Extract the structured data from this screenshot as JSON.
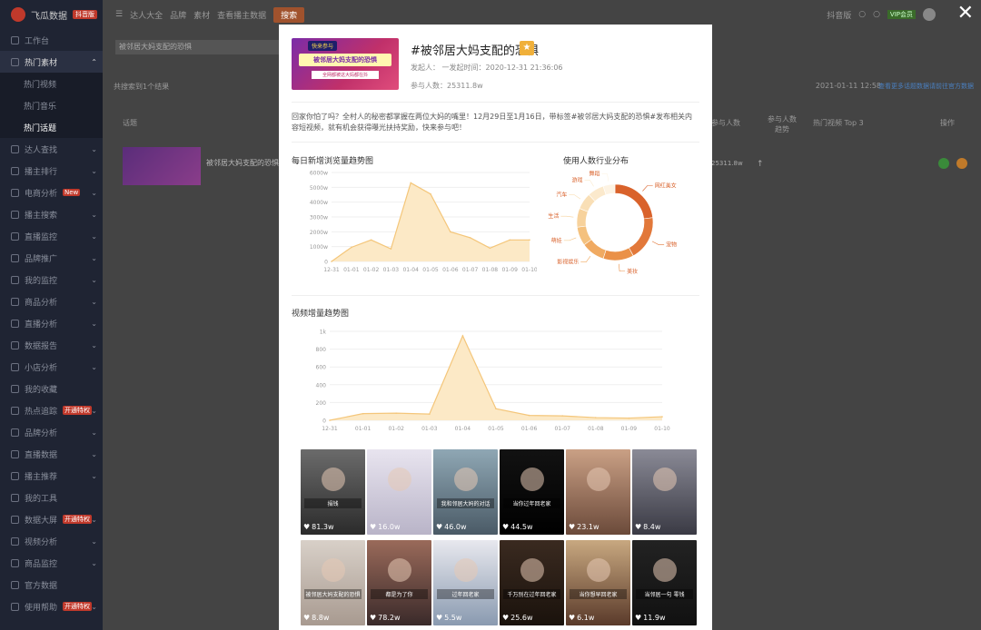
{
  "sidebar": {
    "logo": "飞瓜数据",
    "logo_badge": "抖音版",
    "items": [
      {
        "label": "工作台",
        "chev": ""
      },
      {
        "label": "热门素材",
        "chev": "⌃",
        "active": true
      },
      {
        "label": "热门视频",
        "sub": true
      },
      {
        "label": "热门音乐",
        "sub": true
      },
      {
        "label": "热门话题",
        "sub": true,
        "active": true
      },
      {
        "label": "达人查找",
        "chev": "⌄"
      },
      {
        "label": "播主排行",
        "chev": "⌄"
      },
      {
        "label": "电商分析",
        "chev": "⌄",
        "badge": "New"
      },
      {
        "label": "播主搜索",
        "chev": "⌄"
      },
      {
        "label": "直播监控",
        "chev": "⌄"
      },
      {
        "label": "品牌推广",
        "chev": "⌄"
      },
      {
        "label": "我的监控",
        "chev": "⌄"
      },
      {
        "label": "商品分析",
        "chev": "⌄"
      },
      {
        "label": "直播分析",
        "chev": "⌄"
      },
      {
        "label": "数据报告",
        "chev": "⌄"
      },
      {
        "label": "小店分析",
        "chev": "⌄"
      },
      {
        "label": "我的收藏",
        "chev": ""
      },
      {
        "label": "热点追踪",
        "chev": "⌄",
        "badge": "开通特权"
      },
      {
        "label": "品牌分析",
        "chev": "⌄"
      },
      {
        "label": "直播数据",
        "chev": "⌄"
      },
      {
        "label": "播主推荐",
        "chev": "⌄"
      },
      {
        "label": "我的工具",
        "chev": ""
      },
      {
        "label": "数据大屏",
        "chev": "⌄",
        "badge": "开通特权"
      },
      {
        "label": "视频分析",
        "chev": "⌄"
      },
      {
        "label": "商品监控",
        "chev": "⌄"
      },
      {
        "label": "官方数据",
        "chev": ""
      },
      {
        "label": "使用帮助",
        "chev": "⌄",
        "badge": "开通特权"
      }
    ]
  },
  "topbar": {
    "links": [
      "达人大全",
      "品牌",
      "素材",
      "查看播主数据"
    ],
    "button": "搜索",
    "right_text": "抖音版",
    "vip": "VIP会员"
  },
  "search": {
    "placeholder": "被邻居大妈支配的恐惧"
  },
  "results": {
    "summary": "共搜索到1个结果",
    "date": "2021-01-11 12:58",
    "link": "查看更多话题数据请前往官方数据",
    "headers": [
      "话题",
      "参与人数",
      "参与人数趋势",
      "热门视频 Top 3",
      "操作"
    ],
    "row_title": "被邻居大妈支配的恐惧",
    "row_count": "25311.8w",
    "row_arrow": "↑"
  },
  "modal": {
    "banner_tag": "快来参与",
    "banner_main": "被邻居大妈支配的恐惧",
    "banner_sub": "全网都被这大妈都在抖",
    "title": "#被邻居大妈支配的恐惧",
    "star": "★",
    "meta_initiator": "发起人：  一发起时间：2020-12-31 21:36:06",
    "meta_participants": "参与人数：25311.8w",
    "description": "回家你怕了吗？全村人的秘密都掌握在两位大妈的嘴里！12月29日至1月16日，带标签#被邻居大妈支配的恐惧#发布相关内容短视频，就有机会获得曝光扶持奖励，快来参与吧！",
    "close": "✕"
  },
  "chart_data": [
    {
      "type": "area",
      "title": "每日新增浏览量趋势图",
      "categories": [
        "12-31",
        "01-01",
        "01-02",
        "01-03",
        "01-04",
        "01-05",
        "01-06",
        "01-07",
        "01-08",
        "01-09",
        "01-10"
      ],
      "values": [
        0,
        950,
        1450,
        850,
        5300,
        4550,
        2000,
        1600,
        900,
        1450,
        1450
      ],
      "ylim": [
        0,
        6000
      ],
      "yticks": [
        "0",
        "1000w",
        "2000w",
        "3000w",
        "4000w",
        "5000w",
        "6000w"
      ],
      "color": "#f4c67a"
    },
    {
      "type": "pie",
      "title": "使用人数行业分布",
      "labels": [
        "网红美女",
        "宠物",
        "美妆",
        "影视娱乐",
        "萌娃",
        "生活",
        "汽车",
        "游戏",
        "舞蹈"
      ],
      "values": [
        23,
        19,
        13,
        10,
        8,
        8,
        7,
        7,
        5
      ],
      "colors": [
        "#d9622b",
        "#e2783a",
        "#ea9148",
        "#f0aa62",
        "#f4c17e",
        "#f7d29c",
        "#f9dfb6",
        "#fbe9cc",
        "#fdf3e3"
      ]
    },
    {
      "type": "area",
      "title": "视频增量趋势图",
      "categories": [
        "12-31",
        "01-01",
        "01-02",
        "01-03",
        "01-04",
        "01-05",
        "01-06",
        "01-07",
        "01-08",
        "01-09",
        "01-10"
      ],
      "values": [
        0,
        75,
        80,
        70,
        950,
        130,
        55,
        50,
        30,
        25,
        40
      ],
      "ylim": [
        0,
        1000
      ],
      "yticks": [
        "0",
        "200",
        "400",
        "600",
        "800",
        "1k"
      ],
      "color": "#f4c67a"
    }
  ],
  "videos": [
    {
      "likes": "81.3w",
      "caption": "捐钱"
    },
    {
      "likes": "16.0w",
      "caption": ""
    },
    {
      "likes": "46.0w",
      "caption": "我和邻居大妈的对话"
    },
    {
      "likes": "44.5w",
      "caption": "当你过年回老家"
    },
    {
      "likes": "23.1w",
      "caption": ""
    },
    {
      "likes": "8.4w",
      "caption": ""
    },
    {
      "likes": "8.8w",
      "caption": "被邻居大妈支配的恐惧"
    },
    {
      "likes": "78.2w",
      "caption": "都是为了你"
    },
    {
      "likes": "5.5w",
      "caption": "过年回老家"
    },
    {
      "likes": "25.6w",
      "caption": "千万别在过年回老家"
    },
    {
      "likes": "6.1w",
      "caption": "当你想早回老家"
    },
    {
      "likes": "11.9w",
      "caption": "当邻居一句 零钱"
    }
  ]
}
